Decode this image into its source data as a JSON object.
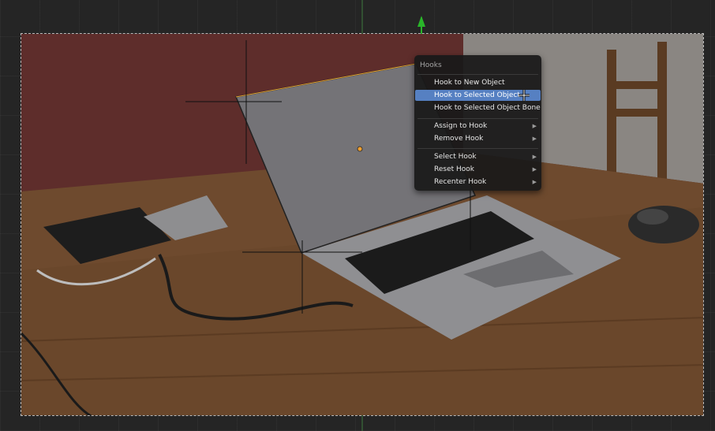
{
  "menu": {
    "title": "Hooks",
    "items": [
      {
        "label": "Hook to New Object",
        "submenu": false,
        "active": false
      },
      {
        "label": "Hook to Selected Object",
        "submenu": false,
        "active": true
      },
      {
        "label": "Hook to Selected Object Bone",
        "submenu": false,
        "active": false
      },
      {
        "label": "Assign to Hook",
        "submenu": true,
        "active": false
      },
      {
        "label": "Remove Hook",
        "submenu": true,
        "active": false
      },
      {
        "label": "Select Hook",
        "submenu": true,
        "active": false
      },
      {
        "label": "Reset Hook",
        "submenu": true,
        "active": false
      },
      {
        "label": "Recenter Hook",
        "submenu": true,
        "active": false
      }
    ]
  },
  "icons": {
    "submenu_arrow": "chevron-right-icon",
    "cursor": "crosshair-cursor-icon"
  },
  "colors": {
    "menu_highlight": "#5680c2",
    "y_axis": "#1fa01f",
    "origin": "#f0a030",
    "edge_selected": "#e0a030"
  }
}
